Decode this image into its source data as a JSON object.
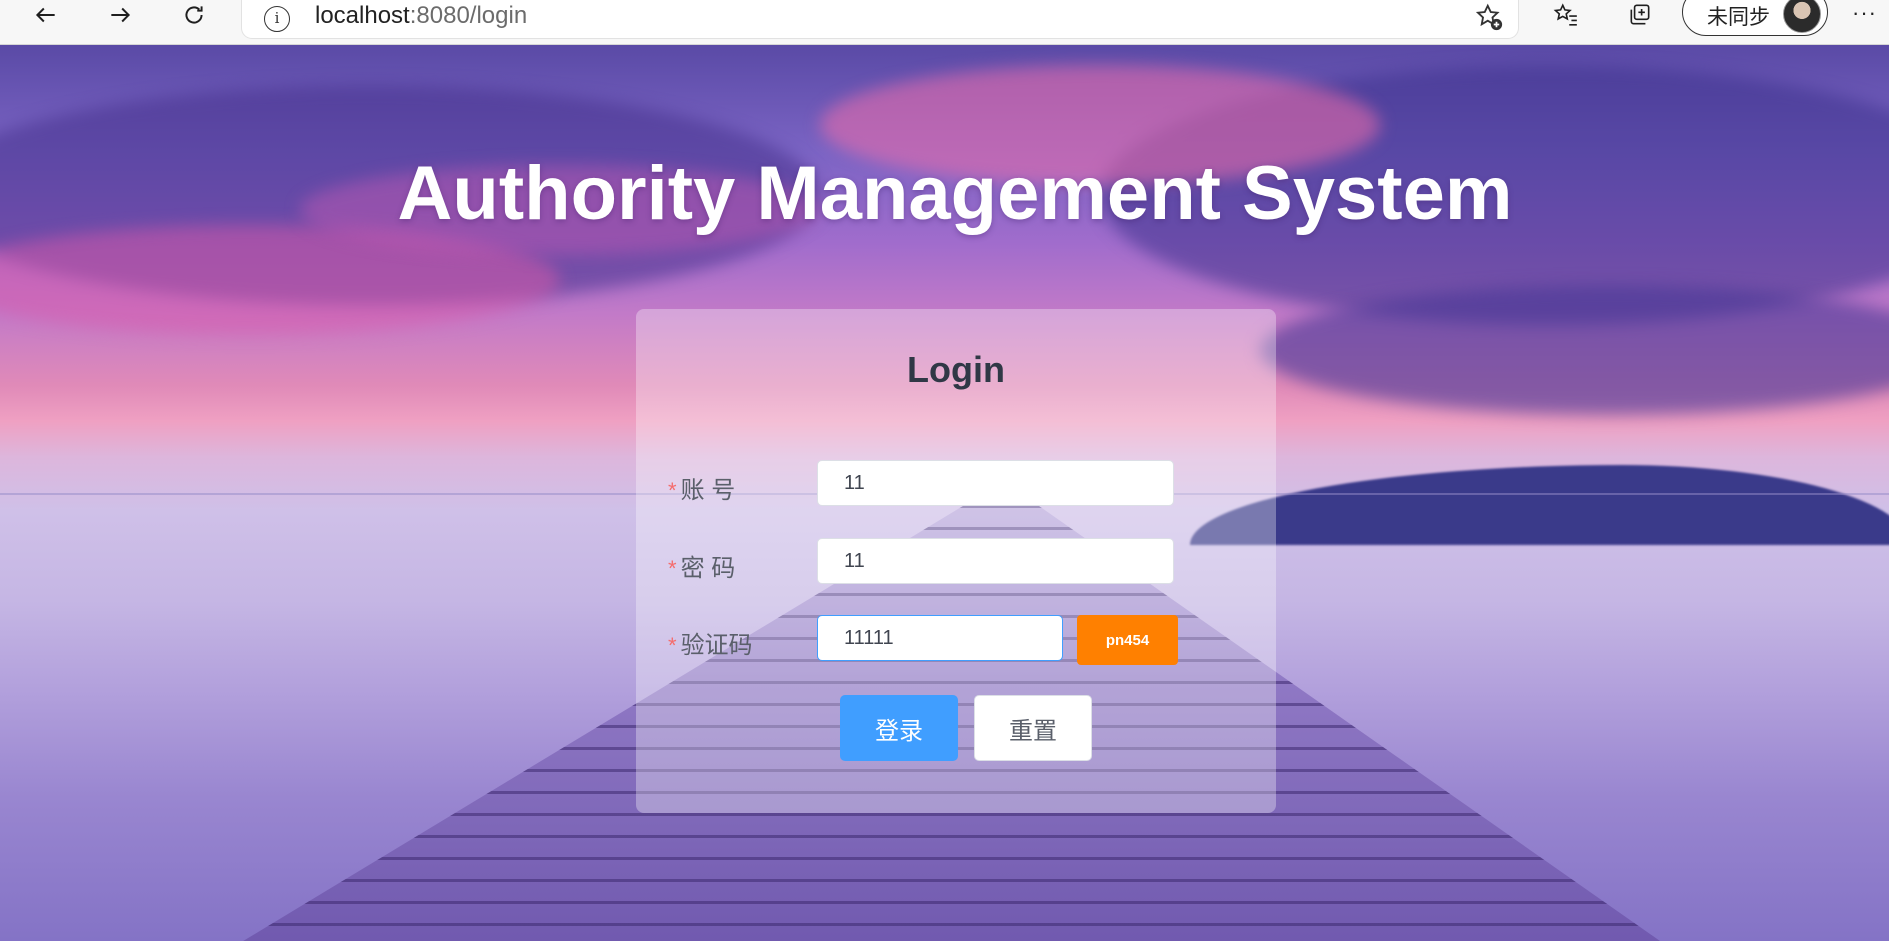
{
  "browser": {
    "url_host": "localhost",
    "url_path": ":8080/login",
    "info_glyph": "i",
    "sync_label": "未同步",
    "more_label": "···",
    "icons": [
      "back-icon",
      "forward-icon",
      "refresh-icon",
      "info-icon",
      "add-favorite-icon",
      "favorites-icon",
      "collections-icon",
      "avatar",
      "more-icon"
    ]
  },
  "page": {
    "title": "Authority Management System"
  },
  "login": {
    "title": "Login",
    "required_mark": "*",
    "account_label": "账 号",
    "account_value": "11",
    "password_label": "密 码",
    "password_value": "11",
    "captcha_label": "验证码",
    "captcha_value": "11111",
    "captcha_code": "pn454",
    "login_button": "登录",
    "reset_button": "重置"
  },
  "colors": {
    "primary": "#409eff",
    "captcha_bg": "#ff8000",
    "required": "#f56c6c"
  }
}
